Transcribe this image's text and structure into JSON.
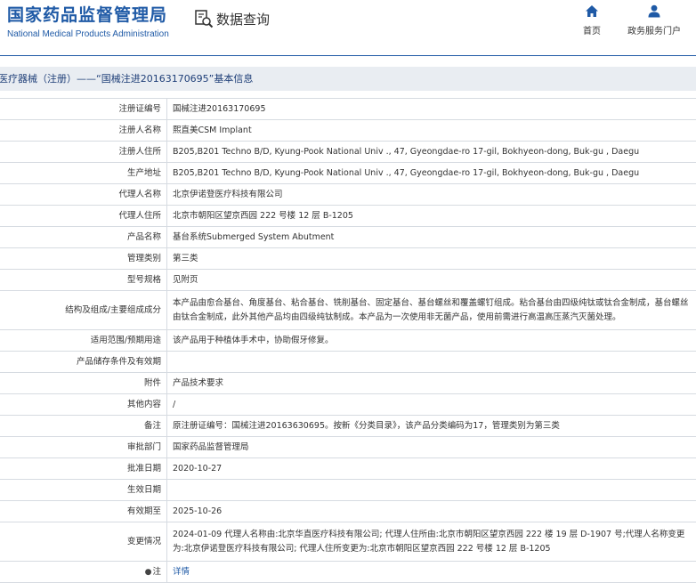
{
  "header": {
    "agency_cn": "国家药品监督管理局",
    "agency_en": "National Medical Products Administration",
    "query_label": "数据查询",
    "nav": [
      {
        "label": "首页",
        "icon": "home-icon"
      },
      {
        "label": "政务服务门户",
        "icon": "user-icon"
      }
    ]
  },
  "title": "医疗器械（注册）——“国械注进20163170695”基本信息",
  "rows": [
    {
      "label": "注册证编号",
      "value": "国械注进20163170695",
      "h": 24
    },
    {
      "label": "注册人名称",
      "value": "熙直美CSM Implant",
      "h": 24
    },
    {
      "label": "注册人住所",
      "value": "B205,B201 Techno B/D, Kyung-Pook National Univ ., 47, Gyeongdae-ro 17-gil, Bokhyeon-dong, Buk-gu , Daegu",
      "h": 24
    },
    {
      "label": "生产地址",
      "value": "B205,B201 Techno B/D, Kyung-Pook National Univ ., 47, Gyeongdae-ro 17-gil, Bokhyeon-dong, Buk-gu , Daegu",
      "h": 24
    },
    {
      "label": "代理人名称",
      "value": "北京伊诺登医疗科技有限公司",
      "h": 24
    },
    {
      "label": "代理人住所",
      "value": "北京市朝阳区望京西园 222 号楼 12 层 B-1205",
      "h": 24
    },
    {
      "label": "产品名称",
      "value": "基台系统Submerged System Abutment",
      "h": 24
    },
    {
      "label": "管理类别",
      "value": "第三类",
      "h": 24
    },
    {
      "label": "型号规格",
      "value": "见附页",
      "h": 24
    },
    {
      "label": "结构及组成/主要组成成分",
      "value": "本产品由愈合基台、角度基台、粘合基台、铣削基台、固定基台、基台螺丝和覆盖螺钉组成。粘合基台由四级纯钛或钛合金制成，基台螺丝由钛合金制成，此外其他产品均由四级纯钛制成。本产品为一次使用非无菌产品，使用前需进行高温高压蒸汽灭菌处理。",
      "h": 44
    },
    {
      "label": "适用范围/预期用途",
      "value": "该产品用于种植体手术中，协助假牙修复。",
      "h": 24
    },
    {
      "label": "产品储存条件及有效期",
      "value": "",
      "h": 24
    },
    {
      "label": "附件",
      "value": "产品技术要求",
      "h": 24
    },
    {
      "label": "其他内容",
      "value": "/",
      "h": 24
    },
    {
      "label": "备注",
      "value": "原注册证编号：国械注进20163630695。按新《分类目录》，该产品分类编码为17，管理类别为第三类",
      "h": 24
    },
    {
      "label": "审批部门",
      "value": "国家药品监督管理局",
      "h": 24
    },
    {
      "label": "批准日期",
      "value": "2020-10-27",
      "h": 24
    },
    {
      "label": "生效日期",
      "value": "",
      "h": 24
    },
    {
      "label": "有效期至",
      "value": "2025-10-26",
      "h": 24
    },
    {
      "label": "变更情况",
      "value": "2024-01-09 代理人名称由:北京华直医疗科技有限公司; 代理人住所由:北京市朝阳区望京西园 222 楼 19 层 D-1907 号;代理人名称变更为:北京伊诺登医疗科技有限公司; 代理人住所变更为:北京市朝阳区望京西园 222 号楼 12 层 B-1205",
      "h": 44
    },
    {
      "label": "注",
      "value": "详情",
      "h": 24,
      "pin": "●",
      "is_link": true
    }
  ]
}
